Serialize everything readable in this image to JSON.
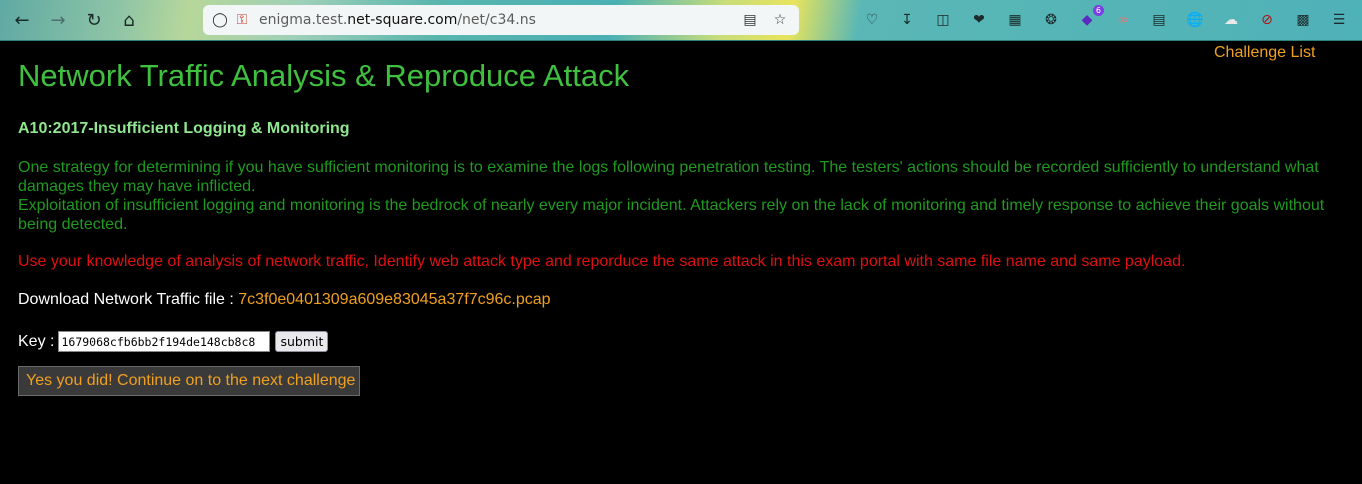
{
  "browser": {
    "url_domain_prefix": "enigma.test.",
    "url_domain": "net-square.com",
    "url_path": "/net/c34.ns",
    "extension_badge_count": "6"
  },
  "page": {
    "challenge_list_link": "Challenge List",
    "title": "Network Traffic Analysis & Reproduce Attack",
    "subtitle": "A10:2017-Insufficient Logging & Monitoring",
    "description_1": "One strategy for determining if you have sufficient monitoring is to examine the logs following penetration testing. The testers' actions should be recorded sufficiently to understand what damages they may have inflicted.",
    "description_2": "Exploitation of insufficient logging and monitoring is the bedrock of nearly every major incident. Attackers rely on the lack of monitoring and timely response to achieve their goals without being detected.",
    "instruction": "Use your knowledge of analysis of network traffic, Identify web attack type and reporduce the same attack in this exam portal with same file name and same payload.",
    "download_label": "Download Network Traffic file : ",
    "download_file": "7c3f0e0401309a609e83045a37f7c96c.pcap",
    "key_label": "Key : ",
    "key_value": "1679068cfb6bb2f194de148cb8c8",
    "submit_label": "submit",
    "success_message": "Yes you did! Continue on to the next challenge"
  },
  "colors": {
    "title": "#3fc03f",
    "description": "#1f9a1f",
    "instruction": "#e01010",
    "link": "#f0a020",
    "background": "#000000"
  }
}
